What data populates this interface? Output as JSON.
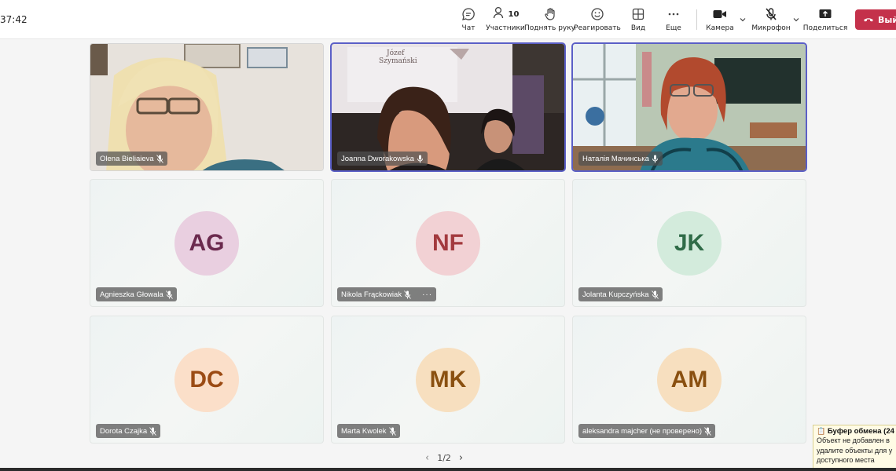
{
  "toolbar": {
    "timer": "37:42",
    "chat": "Чат",
    "participants": "Участники",
    "participants_count": "10",
    "raise_hand": "Поднять руку",
    "react": "Реагировать",
    "view": "Вид",
    "more": "Еще",
    "camera": "Камера",
    "mic": "Микрофон",
    "share": "Поделиться",
    "leave": "Выйти"
  },
  "tiles": [
    {
      "name": "Olena Bieliaieva"
    },
    {
      "name": "Joanna Dworakowska"
    },
    {
      "name": "Наталія Мачинська"
    },
    {
      "name": "Agnieszka Głowala",
      "initials": "AG",
      "bg": "#e9cfe0",
      "fg": "#6b2a4e"
    },
    {
      "name": "Nikola Frąckowiak",
      "initials": "NF",
      "bg": "#f2d1d4",
      "fg": "#a33a3e",
      "more": "···"
    },
    {
      "name": "Jolanta Kupczyńska",
      "initials": "JK",
      "bg": "#d3ebdc",
      "fg": "#2f6b47"
    },
    {
      "name": "Dorota Czajka",
      "initials": "DC",
      "bg": "#fbdfc9",
      "fg": "#9b4b14"
    },
    {
      "name": "Marta Kwolek",
      "initials": "MK",
      "bg": "#f7dfbf",
      "fg": "#8a5010"
    },
    {
      "name": "aleksandra majcher (не проверено)",
      "initials": "AM",
      "bg": "#f7dfbf",
      "fg": "#8a5010"
    }
  ],
  "pager": {
    "label": "1/2"
  },
  "notification": {
    "title": "Буфер обмена (24",
    "line1": "Объект не добавлен в",
    "line2": "удалите объекты для у",
    "line3": "доступного места"
  },
  "colors": {
    "accent": "#5b5fc7",
    "leave": "#c4314b"
  }
}
